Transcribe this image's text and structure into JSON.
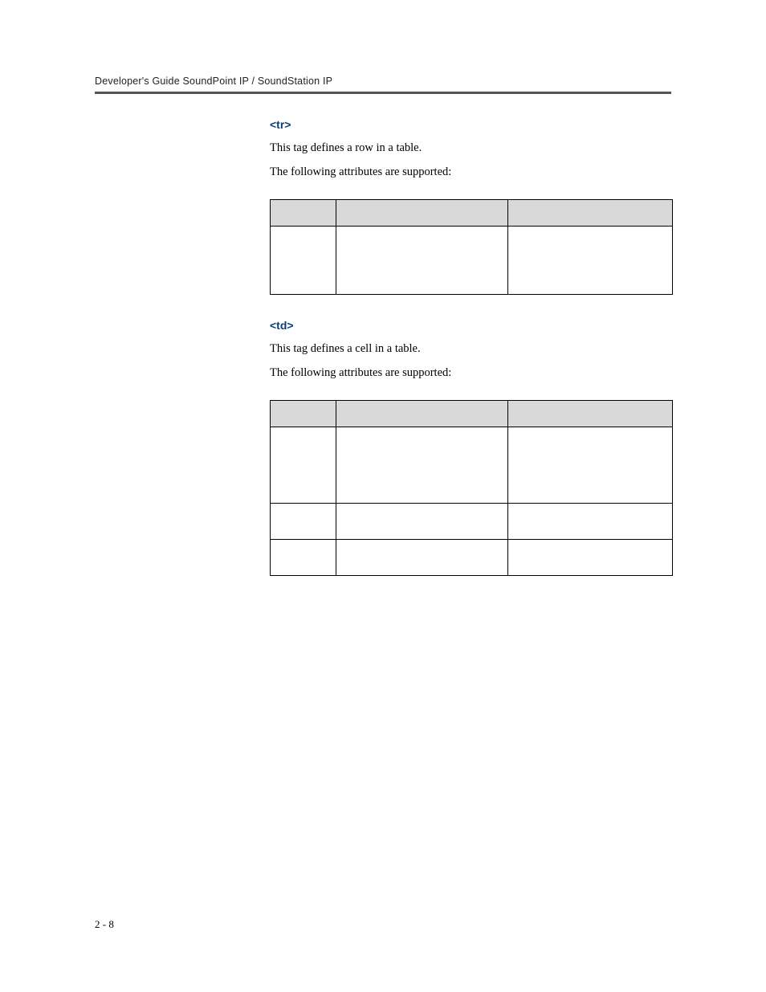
{
  "header": {
    "running_head": "Developer's Guide SoundPoint IP / SoundStation IP"
  },
  "sections": {
    "tr": {
      "heading": "<tr>",
      "para1": "This tag defines a row in a table.",
      "para2": "The following attributes are supported:"
    },
    "td": {
      "heading": "<td>",
      "para1": "This tag defines a cell in a table.",
      "para2": "The following attributes are supported:"
    }
  },
  "footer": {
    "page_number": "2 - 8"
  }
}
